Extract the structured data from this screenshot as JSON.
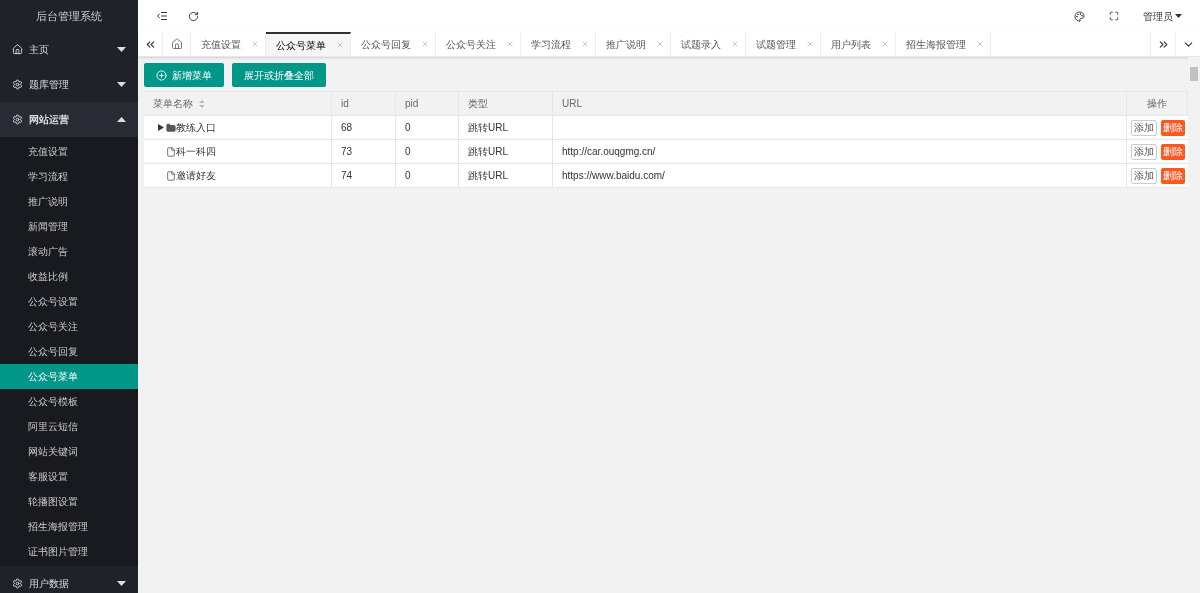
{
  "brand": "后台管理系统",
  "nav": [
    {
      "label": "主页",
      "expanded": false
    },
    {
      "label": "题库管理",
      "expanded": false
    },
    {
      "label": "网站运营",
      "expanded": true,
      "children": [
        {
          "label": "充值设置",
          "selected": false
        },
        {
          "label": "学习流程",
          "selected": false
        },
        {
          "label": "推广说明",
          "selected": false
        },
        {
          "label": "新闻管理",
          "selected": false
        },
        {
          "label": "滚动广告",
          "selected": false
        },
        {
          "label": "收益比例",
          "selected": false
        },
        {
          "label": "公众号设置",
          "selected": false
        },
        {
          "label": "公众号关注",
          "selected": false
        },
        {
          "label": "公众号回复",
          "selected": false
        },
        {
          "label": "公众号菜单",
          "selected": true
        },
        {
          "label": "公众号模板",
          "selected": false
        },
        {
          "label": "阿里云短信",
          "selected": false
        },
        {
          "label": "网站关键词",
          "selected": false
        },
        {
          "label": "客服设置",
          "selected": false
        },
        {
          "label": "轮播图设置",
          "selected": false
        },
        {
          "label": "招生海报管理",
          "selected": false
        },
        {
          "label": "证书图片管理",
          "selected": false
        }
      ]
    },
    {
      "label": "用户数据",
      "expanded": false
    }
  ],
  "user": "管理员",
  "tabs": [
    {
      "label": "充值设置",
      "selected": false
    },
    {
      "label": "公众号菜单",
      "selected": true
    },
    {
      "label": "公众号回复",
      "selected": false
    },
    {
      "label": "公众号关注",
      "selected": false
    },
    {
      "label": "学习流程",
      "selected": false
    },
    {
      "label": "推广说明",
      "selected": false
    },
    {
      "label": "试题录入",
      "selected": false
    },
    {
      "label": "试题管理",
      "selected": false
    },
    {
      "label": "用户列表",
      "selected": false
    },
    {
      "label": "招生海报管理",
      "selected": false
    }
  ],
  "toolbar": {
    "add_button": "新增菜单",
    "toggle_button": "展开或折叠全部"
  },
  "table": {
    "columns": [
      "菜单名称",
      "id",
      "pid",
      "类型",
      "URL",
      "操作"
    ],
    "rows": [
      {
        "name": "教练入口",
        "kind": "folder",
        "expanded": false,
        "id": "68",
        "pid": "0",
        "type": "跳转URL",
        "actions": [
          "添加",
          "删除"
        ]
      },
      {
        "name": "科一科四",
        "kind": "file",
        "id": "73",
        "pid": "0",
        "type": "跳转URL",
        "url": "http://car.ouqgmg.cn/",
        "actions": [
          "添加",
          "删除"
        ]
      },
      {
        "name": "邀请好友",
        "kind": "file",
        "id": "74",
        "pid": "0",
        "type": "跳转URL",
        "url": "https://www.baidu.com/",
        "actions": [
          "添加",
          "删除"
        ]
      }
    ]
  }
}
